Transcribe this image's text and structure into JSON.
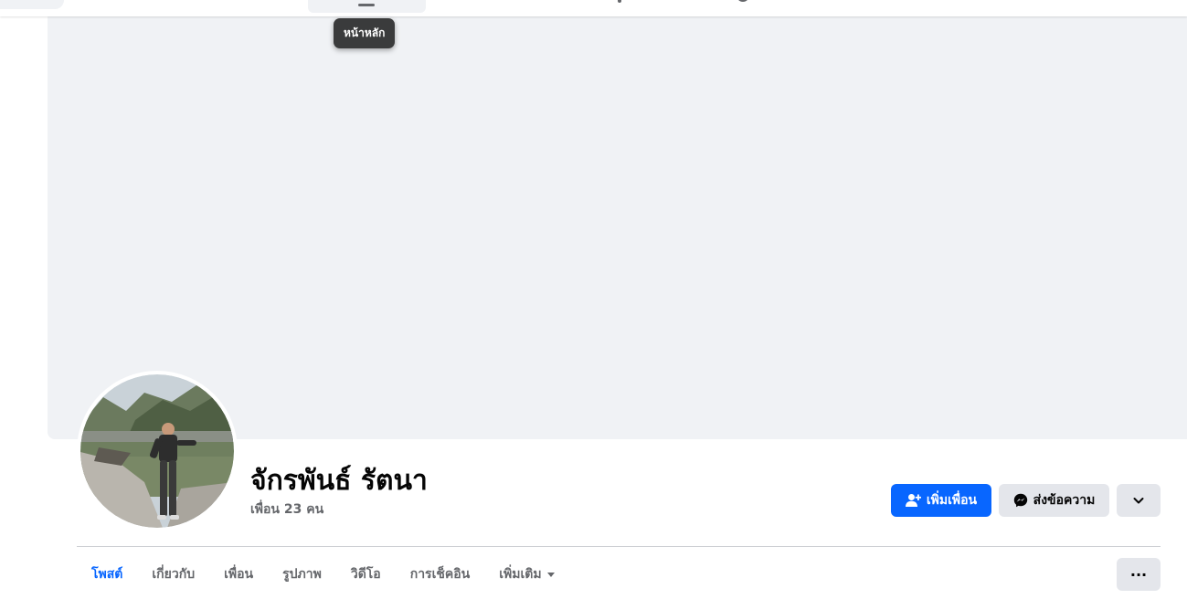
{
  "tooltip": {
    "text": "หน้าหลัก"
  },
  "profile": {
    "name": "จักรพันธ์ รัตนา",
    "friends_count": "เพื่อน 23 คน"
  },
  "actions": {
    "add_friend_label": "เพิ่มเพื่อน",
    "message_label": "ส่งข้อความ"
  },
  "tabs": [
    {
      "label": "โพสต์",
      "active": true
    },
    {
      "label": "เกี่ยวกับ",
      "active": false
    },
    {
      "label": "เพื่อน",
      "active": false
    },
    {
      "label": "รูปภาพ",
      "active": false
    },
    {
      "label": "วิดีโอ",
      "active": false
    },
    {
      "label": "การเช็คอิน",
      "active": false
    },
    {
      "label": "เพิ่มเติม",
      "active": false
    }
  ],
  "more_button": "···",
  "icons": {
    "add_friend": "add-friend-icon",
    "message": "messenger-icon",
    "dropdown": "chevron-down-icon",
    "more_tab": "caret-down-icon"
  },
  "colors": {
    "accent": "#0866ff",
    "cover": "#f0f2f5",
    "secondary_button": "#e4e6eb",
    "muted_text": "#65676b",
    "tooltip_bg": "#3a3b3c"
  }
}
